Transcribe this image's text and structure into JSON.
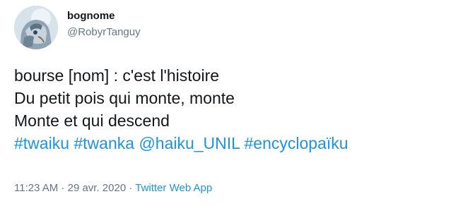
{
  "user": {
    "display_name": "bognome",
    "handle": "@RobyrTanguy"
  },
  "tweet": {
    "lines": [
      "bourse [nom] : c'est l'histoire",
      "Du petit pois qui monte, monte",
      "Monte et qui descend"
    ],
    "hashtags": [
      "#twaiku",
      "#twanka",
      "@haiku_UNIL",
      "#encyclopaïku"
    ]
  },
  "meta": {
    "time": "11:23 AM",
    "separator_1": " · ",
    "date": "29 avr. 2020",
    "separator_2": " · ",
    "source": "Twitter Web App"
  },
  "colors": {
    "link": "#1b95e0",
    "secondary_text": "#657786",
    "primary_text": "#14171a"
  }
}
